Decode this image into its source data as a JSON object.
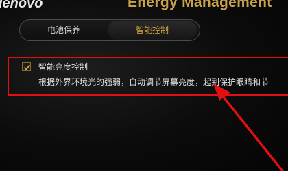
{
  "header": {
    "brand": "lenovo",
    "app_title": "Energy Management"
  },
  "tabs": [
    {
      "label": "电池保养",
      "active": false
    },
    {
      "label": "智能控制",
      "active": true
    }
  ],
  "options": [
    {
      "label": "智能亮度控制",
      "checked": true,
      "description": "根据外界环境光的强弱，自动调节屏幕亮度，起到保护眼睛和节"
    }
  ],
  "colors": {
    "accent": "#d7a640",
    "annotation": "#e01010"
  }
}
